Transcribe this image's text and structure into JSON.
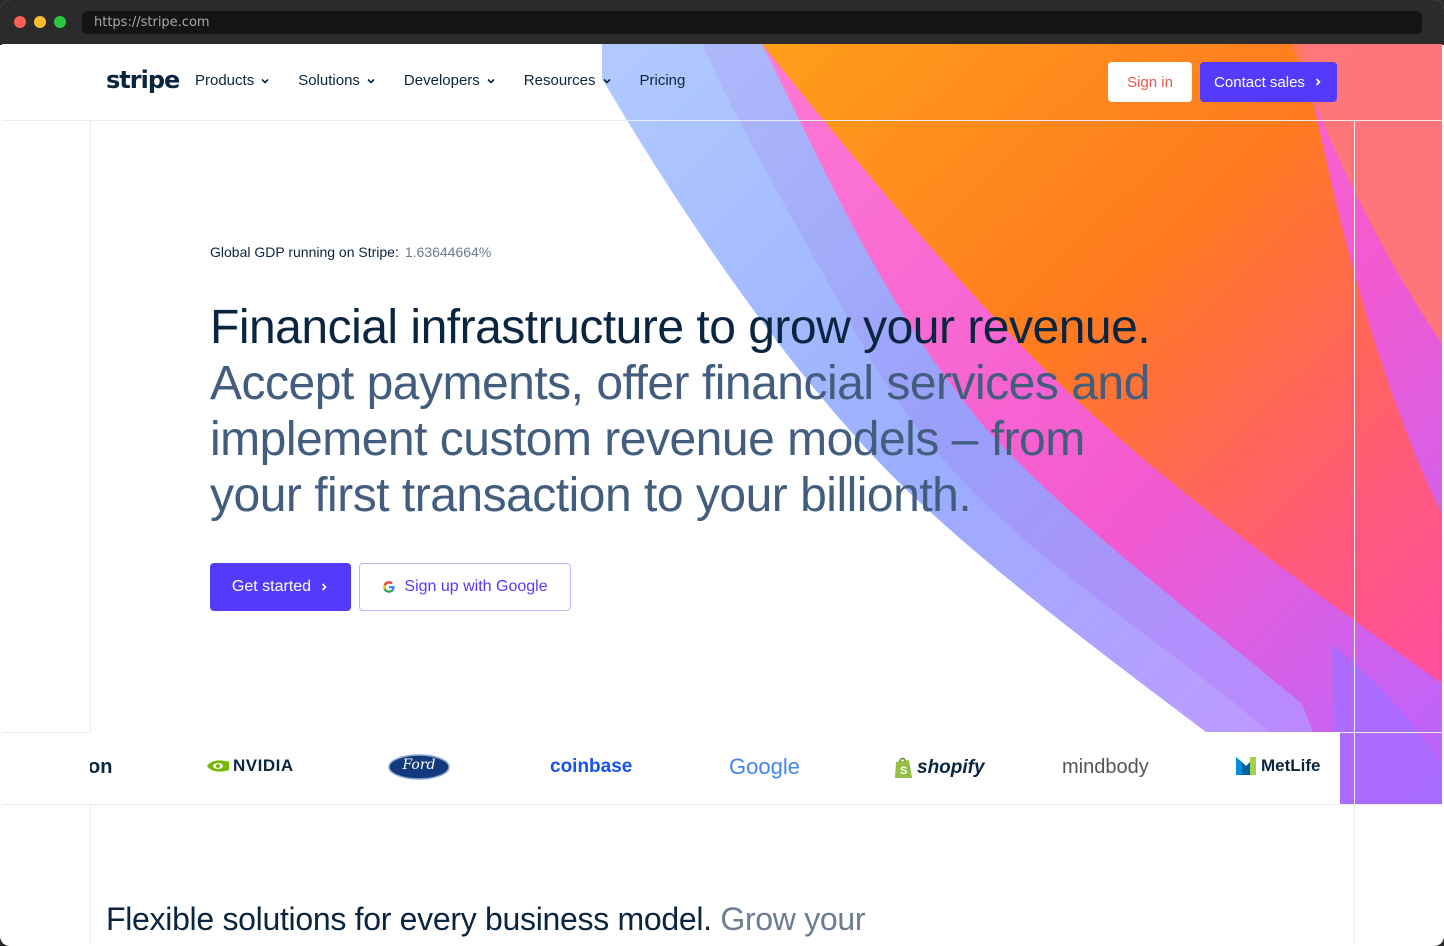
{
  "browser": {
    "url": "https://stripe.com"
  },
  "nav": {
    "logo": "stripe",
    "items": [
      {
        "label": "Products",
        "dropdown": true
      },
      {
        "label": "Solutions",
        "dropdown": true
      },
      {
        "label": "Developers",
        "dropdown": true
      },
      {
        "label": "Resources",
        "dropdown": true
      },
      {
        "label": "Pricing",
        "dropdown": false
      }
    ],
    "sign_in": "Sign in",
    "contact_sales": "Contact sales"
  },
  "hero": {
    "gdp_label": "Global GDP running on Stripe:",
    "gdp_value": "1.63644664%",
    "headline_strong": "Financial infrastructure to grow your revenue.",
    "headline_soft": "Accept payments, offer financial services and implement custom revenue models – from your first transaction to your billionth.",
    "get_started": "Get started",
    "google_signup": "Sign up with Google"
  },
  "logos": [
    "on",
    "NVIDIA",
    "Ford",
    "coinbase",
    "Google",
    "shopify",
    "mindbody",
    "MetLife"
  ],
  "lower": {
    "title_strong": "Flexible solutions for every business model.",
    "title_soft": "Grow your"
  },
  "colors": {
    "accent": "#533afd",
    "navy": "#0a2540",
    "slate": "#425d7e",
    "signin": "#e25950"
  }
}
